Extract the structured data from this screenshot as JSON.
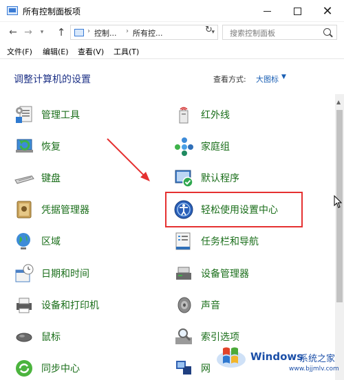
{
  "window": {
    "title": "所有控制面板项"
  },
  "nav": {
    "breadcrumb": [
      "控制...",
      "所有控..."
    ],
    "search_placeholder": "搜索控制面板"
  },
  "menu": [
    {
      "label": "文件(F)"
    },
    {
      "label": "编辑(E)"
    },
    {
      "label": "查看(V)"
    },
    {
      "label": "工具(T)"
    }
  ],
  "content": {
    "title": "调整计算机的设置",
    "view_label": "查看方式:",
    "view_value": "大图标"
  },
  "items_left": [
    {
      "label": "管理工具",
      "icon": "admin-tools-icon"
    },
    {
      "label": "恢复",
      "icon": "recovery-icon"
    },
    {
      "label": "键盘",
      "icon": "keyboard-icon"
    },
    {
      "label": "凭据管理器",
      "icon": "credential-manager-icon"
    },
    {
      "label": "区域",
      "icon": "region-globe-icon"
    },
    {
      "label": "日期和时间",
      "icon": "date-time-icon"
    },
    {
      "label": "设备和打印机",
      "icon": "printer-icon"
    },
    {
      "label": "鼠标",
      "icon": "mouse-icon"
    },
    {
      "label": "同步中心",
      "icon": "sync-center-icon"
    }
  ],
  "items_right": [
    {
      "label": "红外线",
      "icon": "infrared-icon"
    },
    {
      "label": "家庭组",
      "icon": "homegroup-icon"
    },
    {
      "label": "默认程序",
      "icon": "default-programs-icon"
    },
    {
      "label": "轻松使用设置中心",
      "icon": "ease-of-access-icon"
    },
    {
      "label": "任务栏和导航",
      "icon": "taskbar-icon"
    },
    {
      "label": "设备管理器",
      "icon": "device-manager-icon"
    },
    {
      "label": "声音",
      "icon": "sound-icon"
    },
    {
      "label": "索引选项",
      "icon": "indexing-icon"
    },
    {
      "label": "网",
      "icon": "network-icon"
    }
  ],
  "watermark": {
    "title": "Windows",
    "subtitle": "系统之家",
    "url": "www.bjjmlv.com"
  },
  "colors": {
    "link_green": "#1a6e1a",
    "title_blue": "#1e3287",
    "accent_blue": "#1a5fb4",
    "highlight_red": "#e53030"
  }
}
